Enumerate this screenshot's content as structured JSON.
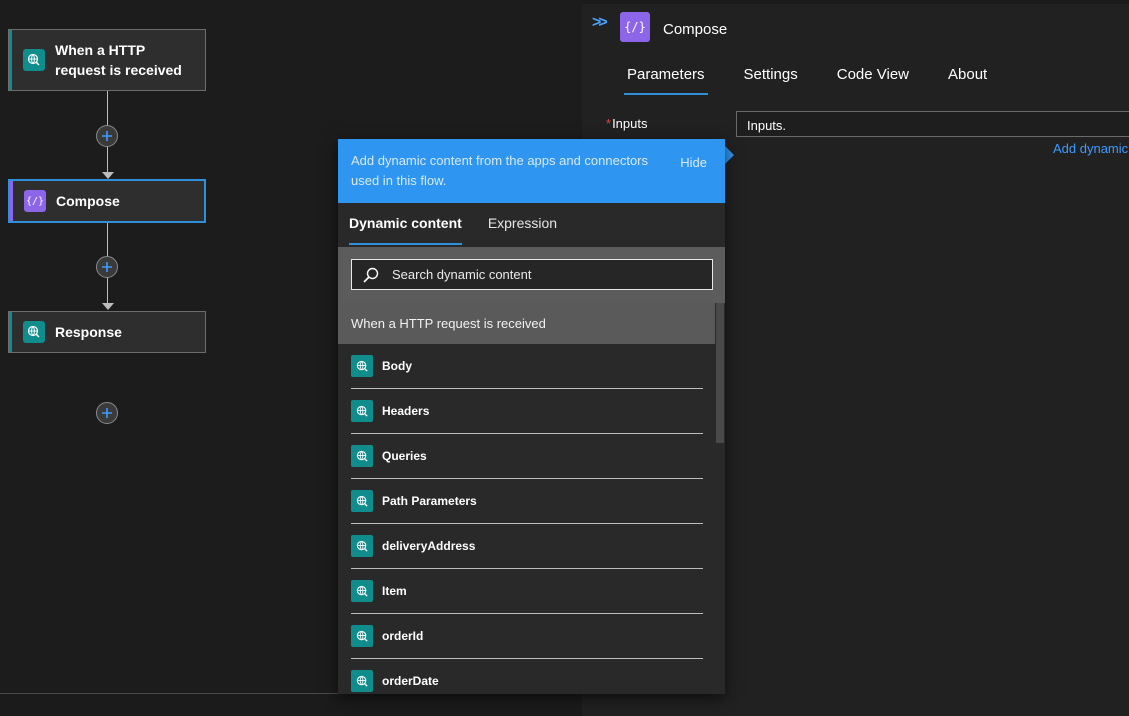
{
  "colors": {
    "http_accent": "#0f8d8d",
    "compose_accent": "#8c65e8",
    "selection_blue": "#2f8fd8",
    "flyout_header": "#2e96f0",
    "link_blue": "#3d9bff"
  },
  "canvas": {
    "nodes": [
      {
        "title": "When a HTTP request is received",
        "icon": "http-globe-icon"
      },
      {
        "title": "Compose",
        "icon": "compose-braces-icon"
      },
      {
        "title": "Response",
        "icon": "http-globe-icon"
      }
    ]
  },
  "panel": {
    "title": "Compose",
    "collapse_icon": "double-chevron-right-icon",
    "tabs": [
      "Parameters",
      "Settings",
      "Code View",
      "About"
    ],
    "active_tab": "Parameters",
    "field": {
      "required_marker": "*",
      "label": "Inputs",
      "value": "Inputs."
    },
    "add_dynamic_link": "Add dynamic c"
  },
  "flyout": {
    "header_text": "Add dynamic content from the apps and connectors used in this flow.",
    "hide_label": "Hide",
    "tabs": [
      "Dynamic content",
      "Expression"
    ],
    "active_tab": "Dynamic content",
    "search_placeholder": "Search dynamic content",
    "section_title": "When a HTTP request is received",
    "items": [
      "Body",
      "Headers",
      "Queries",
      "Path Parameters",
      "deliveryAddress",
      "Item",
      "orderId",
      "orderDate"
    ]
  }
}
